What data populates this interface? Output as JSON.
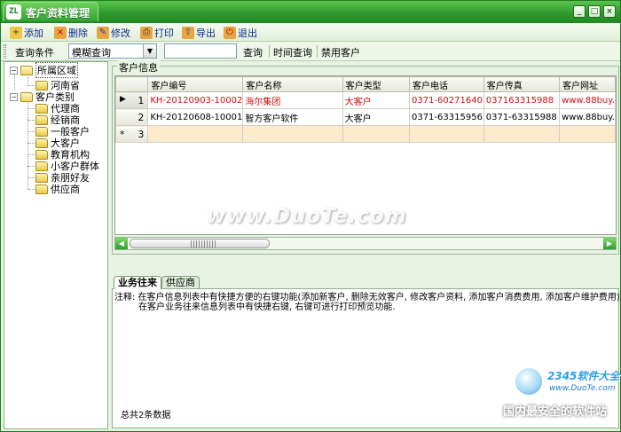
{
  "window": {
    "title": "客户资料管理",
    "icon_text": "ZL",
    "buttons": {
      "minimize": "_",
      "maximize": "□",
      "close": "×"
    }
  },
  "toolbar": {
    "add": "添加",
    "delete": "删除",
    "edit": "修改",
    "print": "打印",
    "export": "导出",
    "exit": "退出"
  },
  "searchbar": {
    "query_label": "查询条件",
    "mode_value": "模糊查询",
    "search_value": "",
    "query_button": "查询",
    "time_query": "时间查询",
    "disable_customer": "禁用客户"
  },
  "tree": {
    "region": "所属区域",
    "region_children": [
      "河南省"
    ],
    "category": "客户类别",
    "category_children": [
      "代理商",
      "经销商",
      "一般客户",
      "大客户",
      "教育机构",
      "小客户群体",
      "亲朋好友",
      "供应商"
    ]
  },
  "customer_info": {
    "legend": "客户信息",
    "columns": [
      "客户编号",
      "客户名称",
      "客户类型",
      "客户电话",
      "客户传真",
      "客户网址"
    ],
    "rows": [
      {
        "marker": "▶",
        "num": "1",
        "cells": [
          "KH-20120903-10002",
          "海尔集团",
          "大客户",
          "0371-60271640",
          "037163315988",
          "www.88buy."
        ]
      },
      {
        "marker": "",
        "num": "2",
        "cells": [
          "KH-20120608-10001",
          "智方客户软件",
          "大客户",
          "0371-63315956",
          "0371-63315988",
          "www.88buy."
        ]
      },
      {
        "marker": "*",
        "num": "3",
        "cells": [
          "",
          "",
          "",
          "",
          "",
          ""
        ]
      }
    ]
  },
  "bottom": {
    "tabs": [
      "业务往来",
      "供应商"
    ],
    "note1": "注释: 在客户信息列表中有快捷方便的右键功能(添加新客户, 删除无效客户, 修改客户资料, 添加客户消费费用, 添加客户维护费用)",
    "note2": "在客户业务往来信息列表中有快捷右键, 右键可进行打印预览功能.",
    "total": "总共2条数据"
  },
  "watermark": {
    "main": "www.DuoTe.com",
    "brand": "2345软件大全",
    "brand_url": "www.DuoTe.com",
    "slogan": "国内最安全的软件站"
  }
}
